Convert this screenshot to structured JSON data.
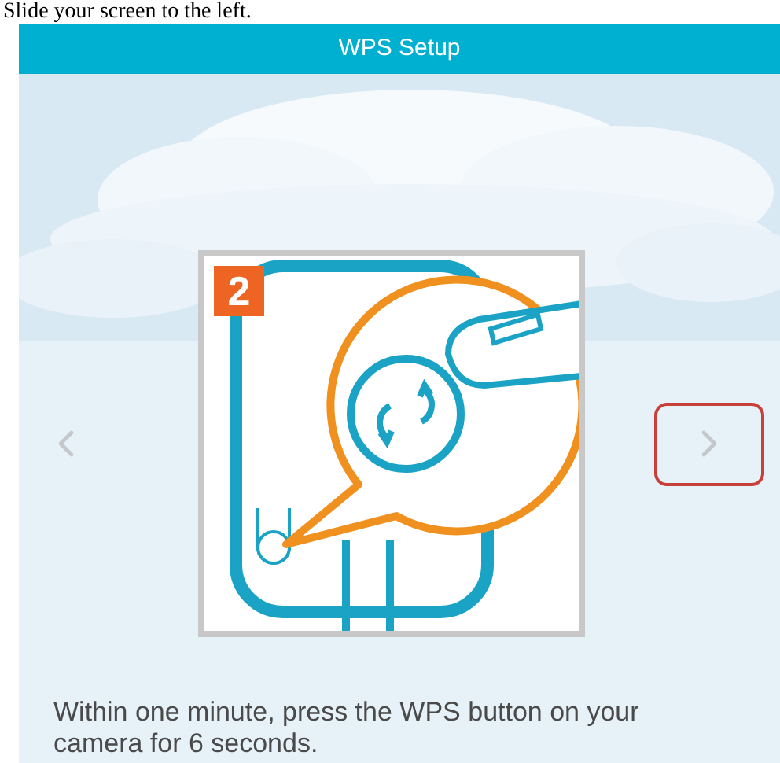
{
  "document_text": "Slide your screen to the left.",
  "screen": {
    "title": "WPS Setup",
    "step_number": "2",
    "instruction": "Within one minute, press the WPS button on your camera for 6 seconds.",
    "next_highlighted": true
  }
}
